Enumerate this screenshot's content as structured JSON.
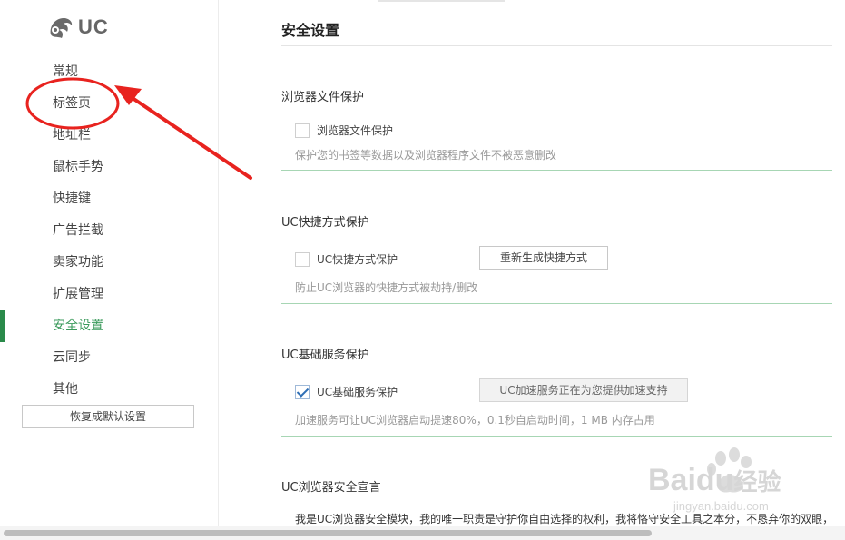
{
  "sidebar": {
    "logo_text": "UC",
    "items": [
      {
        "label": "常规",
        "active": false
      },
      {
        "label": "标签页",
        "active": false
      },
      {
        "label": "地址栏",
        "active": false
      },
      {
        "label": "鼠标手势",
        "active": false
      },
      {
        "label": "快捷键",
        "active": false
      },
      {
        "label": "广告拦截",
        "active": false
      },
      {
        "label": "卖家功能",
        "active": false
      },
      {
        "label": "扩展管理",
        "active": false
      },
      {
        "label": "安全设置",
        "active": true
      },
      {
        "label": "云同步",
        "active": false
      },
      {
        "label": "其他",
        "active": false
      }
    ],
    "reset_label": "恢复成默认设置"
  },
  "main": {
    "title": "安全设置",
    "sections": {
      "file_protect": {
        "title": "浏览器文件保护",
        "checkbox_label": "浏览器文件保护",
        "checked": false,
        "desc": "保护您的书签等数据以及浏览器程序文件不被恶意删改"
      },
      "shortcut_protect": {
        "title": "UC快捷方式保护",
        "checkbox_label": "UC快捷方式保护",
        "checked": false,
        "button_label": "重新生成快捷方式",
        "desc": "防止UC浏览器的快捷方式被劫持/删改"
      },
      "base_service": {
        "title": "UC基础服务保护",
        "checkbox_label": "UC基础服务保护",
        "checked": true,
        "button_label": "UC加速服务正在为您提供加速支持",
        "desc": "加速服务可让UC浏览器启动提速80%，0.1秒自启动时间，1 MB 内存占用"
      },
      "declaration": {
        "title": "UC浏览器安全宣言",
        "text": "我是UC浏览器安全模块，我的唯一职责是守护你自由选择的权利，我将恪守安全工具之本分，不恳弃你的双眼，"
      }
    }
  },
  "watermark": {
    "brand": "Baidu",
    "suffix": "经验",
    "url": "jingyan.baidu.com"
  },
  "colors": {
    "accent": "#2a8a4a",
    "annotation": "#e8231f",
    "divider": "#a7d6b4"
  }
}
